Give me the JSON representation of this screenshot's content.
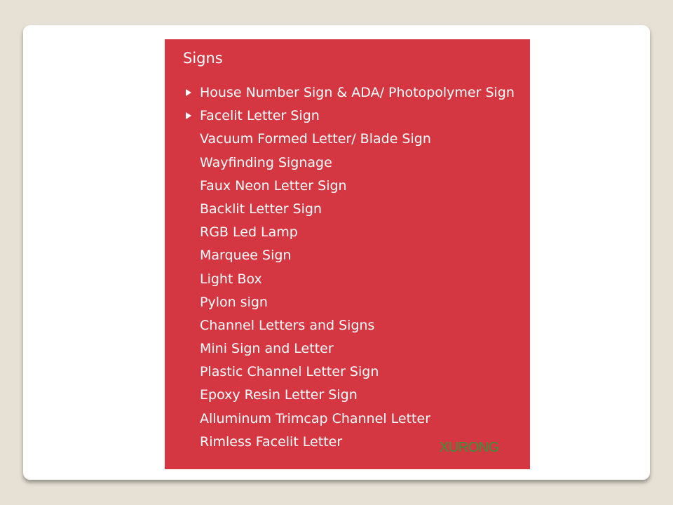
{
  "menu": {
    "title": "Signs",
    "items": [
      {
        "label": "House Number Sign & ADA/ Photopolymer Sign",
        "expandable": true
      },
      {
        "label": "Facelit Letter Sign",
        "expandable": true
      },
      {
        "label": "Vacuum Formed Letter/ Blade Sign",
        "expandable": false
      },
      {
        "label": "Wayfinding Signage",
        "expandable": false
      },
      {
        "label": "Faux Neon Letter Sign",
        "expandable": false
      },
      {
        "label": "Backlit Letter Sign",
        "expandable": false
      },
      {
        "label": "RGB Led Lamp",
        "expandable": false
      },
      {
        "label": "Marquee Sign",
        "expandable": false
      },
      {
        "label": "Light Box",
        "expandable": false
      },
      {
        "label": "Pylon sign",
        "expandable": false
      },
      {
        "label": "Channel Letters and Signs",
        "expandable": false
      },
      {
        "label": "Mini Sign and Letter",
        "expandable": false
      },
      {
        "label": "Plastic Channel Letter Sign",
        "expandable": false
      },
      {
        "label": "Epoxy Resin Letter Sign",
        "expandable": false
      },
      {
        "label": "Alluminum Trimcap Channel Letter",
        "expandable": false
      },
      {
        "label": "Rimless Facelit Letter",
        "expandable": false
      }
    ]
  },
  "brand": {
    "text": "XURONG"
  },
  "colors": {
    "panel_background": "#d43741",
    "menu_text": "#ffffff",
    "brand_text": "#2d9a3a",
    "page_background": "#e6e0d5"
  },
  "icons": {
    "expand_indicator": "triangle-right-icon"
  }
}
